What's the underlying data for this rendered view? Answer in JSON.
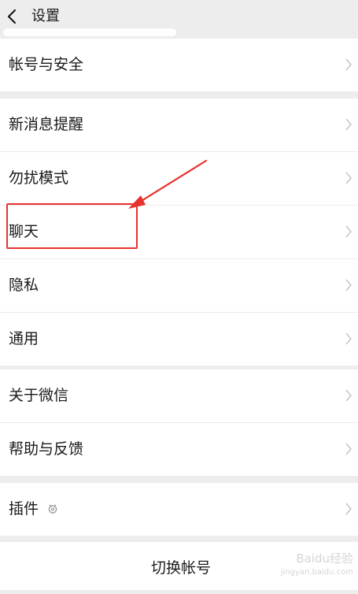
{
  "header": {
    "title": "设置"
  },
  "groups": [
    {
      "items": [
        {
          "label": "帐号与安全"
        }
      ]
    },
    {
      "items": [
        {
          "label": "新消息提醒"
        },
        {
          "label": "勿扰模式"
        },
        {
          "label": "聊天"
        },
        {
          "label": "隐私"
        },
        {
          "label": "通用"
        }
      ]
    },
    {
      "items": [
        {
          "label": "关于微信"
        },
        {
          "label": "帮助与反馈"
        }
      ]
    },
    {
      "items": [
        {
          "label": "插件"
        }
      ]
    }
  ],
  "switch_account": {
    "label": "切换帐号"
  },
  "watermark": {
    "brand": "Baidu经验",
    "url": "jingyan.baidu.com"
  },
  "colors": {
    "annotation": "#e8322f",
    "background": "#ededed",
    "row": "#ffffff"
  },
  "icons": [
    "back-arrow-icon",
    "chevron-right-icon",
    "plugin-gear-icon"
  ]
}
